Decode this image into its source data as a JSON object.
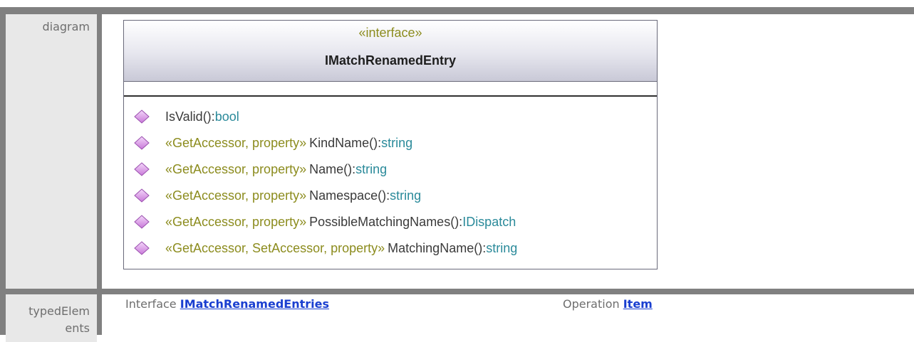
{
  "rows": {
    "diagram_label": "diagram",
    "typed_elements_label_line1": "typedElem",
    "typed_elements_label_line2": "ents"
  },
  "uml": {
    "stereotype": "«interface»",
    "name": "IMatchRenamedEntry",
    "operations": [
      {
        "stereotype": "",
        "name": "IsValid():",
        "type": "bool"
      },
      {
        "stereotype": "«GetAccessor, property»",
        "name": "KindName():",
        "type": "string"
      },
      {
        "stereotype": "«GetAccessor, property»",
        "name": "Name():",
        "type": "string"
      },
      {
        "stereotype": "«GetAccessor, property»",
        "name": "Namespace():",
        "type": "string"
      },
      {
        "stereotype": "«GetAccessor, property»",
        "name": "PossibleMatchingNames():",
        "type": "IDispatch"
      },
      {
        "stereotype": "«GetAccessor, SetAccessor, property»",
        "name": "MatchingName():",
        "type": "string"
      }
    ],
    "operation_icon": "operation-diamond-icon",
    "colors": {
      "stereotype": "#8c8c1e",
      "type": "#2a8a9a",
      "operation_icon": "#c878d8"
    }
  },
  "typed_elements": [
    {
      "kind": "Interface",
      "link": "IMatchRenamedEntries"
    },
    {
      "kind": "Operation",
      "link": "Item"
    }
  ],
  "colors": {
    "link": "#1a3fd0",
    "label_bg": "#e8e8e8",
    "frame": "#808080"
  }
}
